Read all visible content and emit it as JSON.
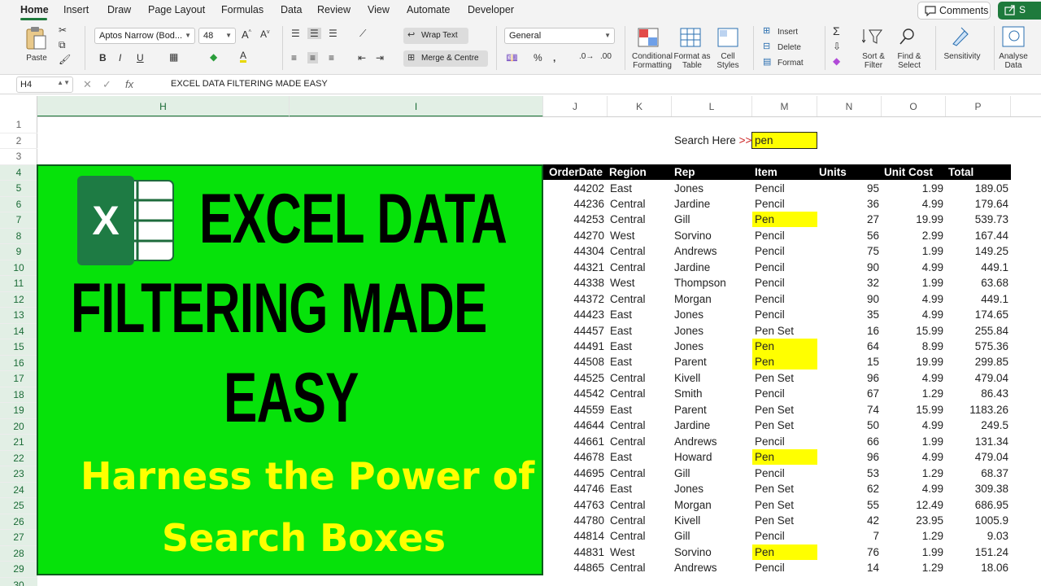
{
  "menu": {
    "tabs": [
      "Home",
      "Insert",
      "Draw",
      "Page Layout",
      "Formulas",
      "Data",
      "Review",
      "View",
      "Automate",
      "Developer"
    ],
    "comments_label": "Comments",
    "share_label": "S"
  },
  "ribbon": {
    "paste_label": "Paste",
    "font_name": "Aptos Narrow (Bod...",
    "font_size": "48",
    "wrap_text": "Wrap Text",
    "merge_centre": "Merge & Centre",
    "number_format": "General",
    "conditional_formatting": "Conditional Formatting",
    "format_as_table": "Format as Table",
    "cell_styles": "Cell Styles",
    "insert": "Insert",
    "delete": "Delete",
    "format": "Format",
    "sort_filter": "Sort & Filter",
    "find_select": "Find & Select",
    "sensitivity": "Sensitivity",
    "analyse_data": "Analyse Data"
  },
  "formula_bar": {
    "name_box": "H4",
    "content": "EXCEL DATA FILTERING MADE EASY"
  },
  "columns": [
    "H",
    "I",
    "J",
    "K",
    "L",
    "M",
    "N",
    "O",
    "P"
  ],
  "rows": [
    "1",
    "2",
    "3",
    "4",
    "5",
    "6",
    "7",
    "8",
    "9",
    "10",
    "11",
    "12",
    "13",
    "14",
    "15",
    "16",
    "17",
    "18",
    "19",
    "20",
    "21",
    "22",
    "23",
    "24",
    "25",
    "26",
    "27",
    "28",
    "29",
    "30"
  ],
  "selected_cell": "H4",
  "banner": {
    "line1": "EXCEL DATA",
    "line2": "FILTERING MADE",
    "line3": "EASY",
    "sub1": "Harness the Power of",
    "sub2": "Search Boxes",
    "bg_color": "#06e20a",
    "sub_color": "#ffff00"
  },
  "search": {
    "label": "Search Here",
    "arrows": ">>",
    "value": "pen",
    "highlight_color": "#ffff00"
  },
  "table": {
    "headers": [
      "OrderDate",
      "Region",
      "Rep",
      "Item",
      "Units",
      "Unit Cost",
      "Total"
    ],
    "rows": [
      [
        "44202",
        "East",
        "Jones",
        "Pencil",
        "95",
        "1.99",
        "189.05"
      ],
      [
        "44236",
        "Central",
        "Jardine",
        "Pencil",
        "36",
        "4.99",
        "179.64"
      ],
      [
        "44253",
        "Central",
        "Gill",
        "Pen",
        "27",
        "19.99",
        "539.73"
      ],
      [
        "44270",
        "West",
        "Sorvino",
        "Pencil",
        "56",
        "2.99",
        "167.44"
      ],
      [
        "44304",
        "Central",
        "Andrews",
        "Pencil",
        "75",
        "1.99",
        "149.25"
      ],
      [
        "44321",
        "Central",
        "Jardine",
        "Pencil",
        "90",
        "4.99",
        "449.1"
      ],
      [
        "44338",
        "West",
        "Thompson",
        "Pencil",
        "32",
        "1.99",
        "63.68"
      ],
      [
        "44372",
        "Central",
        "Morgan",
        "Pencil",
        "90",
        "4.99",
        "449.1"
      ],
      [
        "44423",
        "East",
        "Jones",
        "Pencil",
        "35",
        "4.99",
        "174.65"
      ],
      [
        "44457",
        "East",
        "Jones",
        "Pen Set",
        "16",
        "15.99",
        "255.84"
      ],
      [
        "44491",
        "East",
        "Jones",
        "Pen",
        "64",
        "8.99",
        "575.36"
      ],
      [
        "44508",
        "East",
        "Parent",
        "Pen",
        "15",
        "19.99",
        "299.85"
      ],
      [
        "44525",
        "Central",
        "Kivell",
        "Pen Set",
        "96",
        "4.99",
        "479.04"
      ],
      [
        "44542",
        "Central",
        "Smith",
        "Pencil",
        "67",
        "1.29",
        "86.43"
      ],
      [
        "44559",
        "East",
        "Parent",
        "Pen Set",
        "74",
        "15.99",
        "1183.26"
      ],
      [
        "44644",
        "Central",
        "Jardine",
        "Pen Set",
        "50",
        "4.99",
        "249.5"
      ],
      [
        "44661",
        "Central",
        "Andrews",
        "Pencil",
        "66",
        "1.99",
        "131.34"
      ],
      [
        "44678",
        "East",
        "Howard",
        "Pen",
        "96",
        "4.99",
        "479.04"
      ],
      [
        "44695",
        "Central",
        "Gill",
        "Pencil",
        "53",
        "1.29",
        "68.37"
      ],
      [
        "44746",
        "East",
        "Jones",
        "Pen Set",
        "62",
        "4.99",
        "309.38"
      ],
      [
        "44763",
        "Central",
        "Morgan",
        "Pen Set",
        "55",
        "12.49",
        "686.95"
      ],
      [
        "44780",
        "Central",
        "Kivell",
        "Pen Set",
        "42",
        "23.95",
        "1005.9"
      ],
      [
        "44814",
        "Central",
        "Gill",
        "Pencil",
        "7",
        "1.29",
        "9.03"
      ],
      [
        "44831",
        "West",
        "Sorvino",
        "Pen",
        "76",
        "1.99",
        "151.24"
      ],
      [
        "44865",
        "Central",
        "Andrews",
        "Pencil",
        "14",
        "1.29",
        "18.06"
      ]
    ]
  }
}
